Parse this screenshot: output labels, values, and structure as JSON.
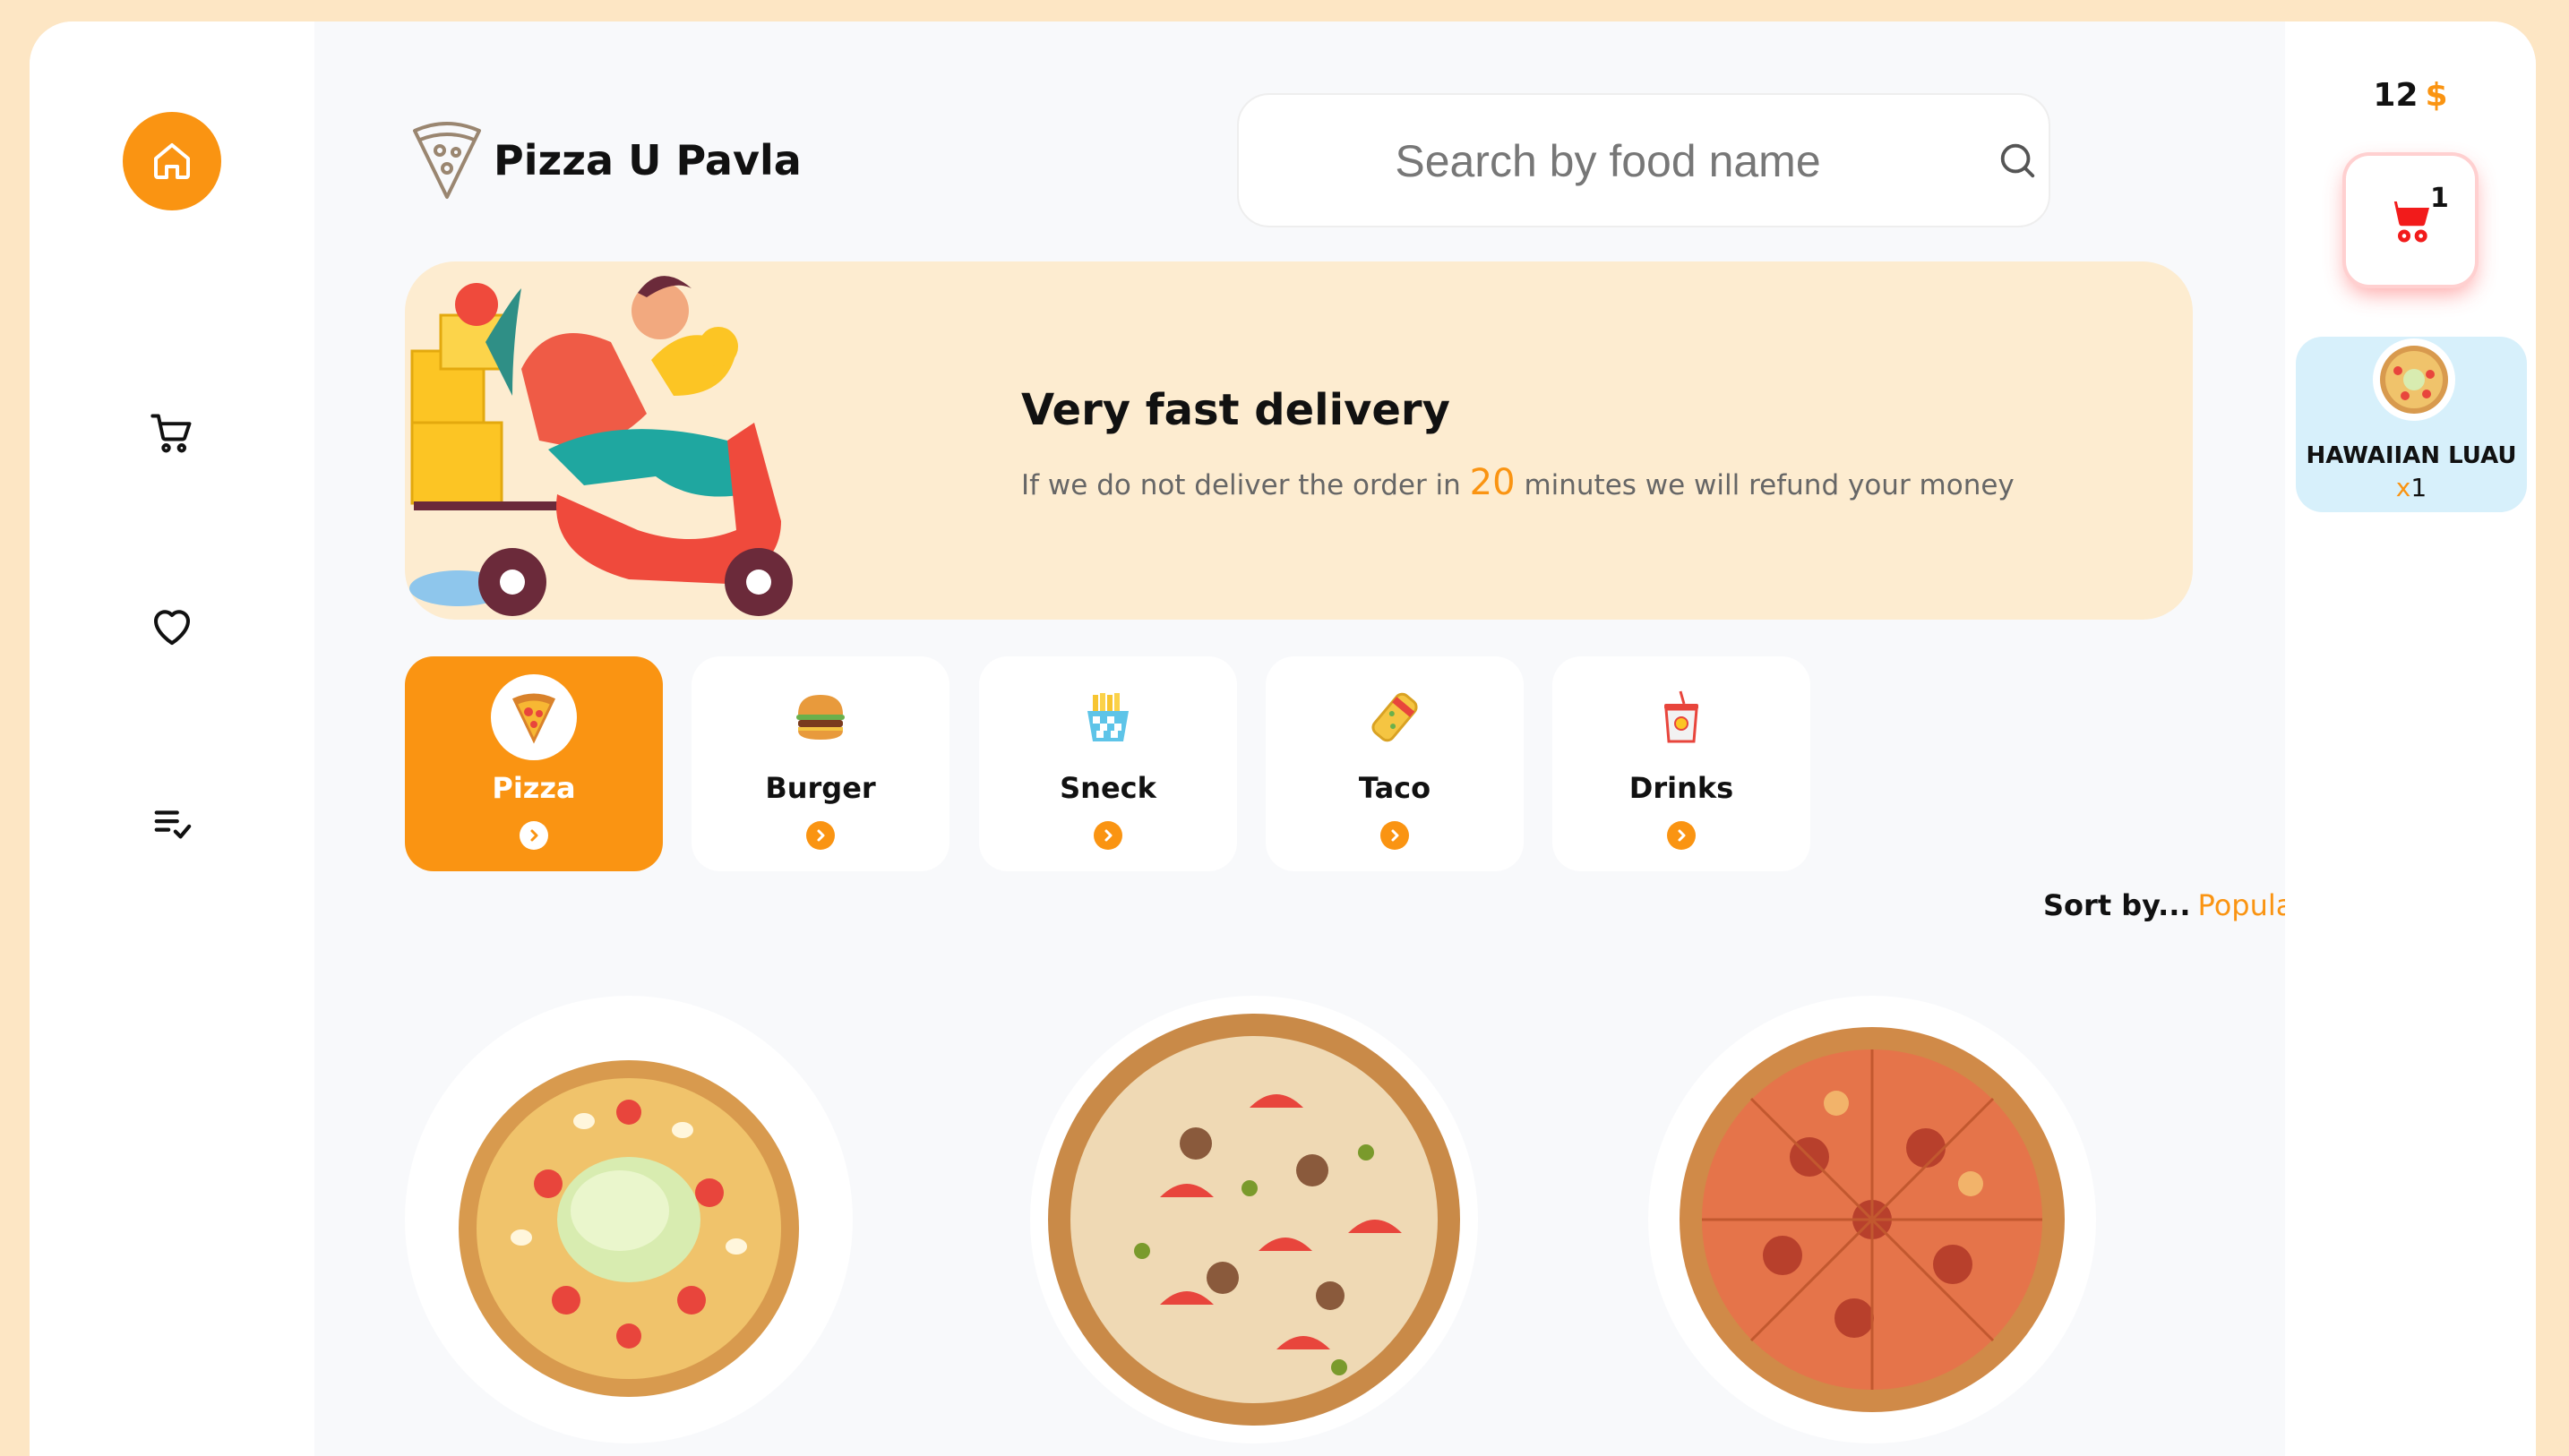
{
  "brand": {
    "name": "Pizza U Pavla"
  },
  "search": {
    "placeholder": "Search by food name"
  },
  "nav": {
    "items": [
      {
        "name": "home",
        "icon": "home-icon",
        "active": true
      },
      {
        "name": "cart",
        "icon": "cart-icon"
      },
      {
        "name": "favorites",
        "icon": "heart-icon"
      },
      {
        "name": "orders",
        "icon": "checklist-icon"
      }
    ]
  },
  "banner": {
    "title": "Very fast delivery",
    "text_before": "If we do not deliver the order in",
    "highlight": "20",
    "text_after": "minutes we will refund your money",
    "illustration": "delivery-scooter-illustration"
  },
  "categories": [
    {
      "label": "Pizza",
      "icon": "pizza-icon",
      "active": true
    },
    {
      "label": "Burger",
      "icon": "burger-icon",
      "active": false
    },
    {
      "label": "Sneck",
      "icon": "fries-icon",
      "active": false
    },
    {
      "label": "Taco",
      "icon": "taco-icon",
      "active": false
    },
    {
      "label": "Drinks",
      "icon": "drink-icon",
      "active": false
    }
  ],
  "sort": {
    "label": "Sort by...",
    "value": "Popular"
  },
  "wallet": {
    "amount": "12",
    "currency": "$"
  },
  "cart": {
    "count": "1",
    "items": [
      {
        "name": "HAWAIIAN LUAU",
        "qty_prefix": "x",
        "qty": "1"
      }
    ]
  },
  "colors": {
    "accent": "#fa9412",
    "page_bg": "#fde6c4",
    "banner_bg": "#fdecd0",
    "cart_item_bg": "#d7f0fb",
    "cart_red": "#f21b1b"
  }
}
